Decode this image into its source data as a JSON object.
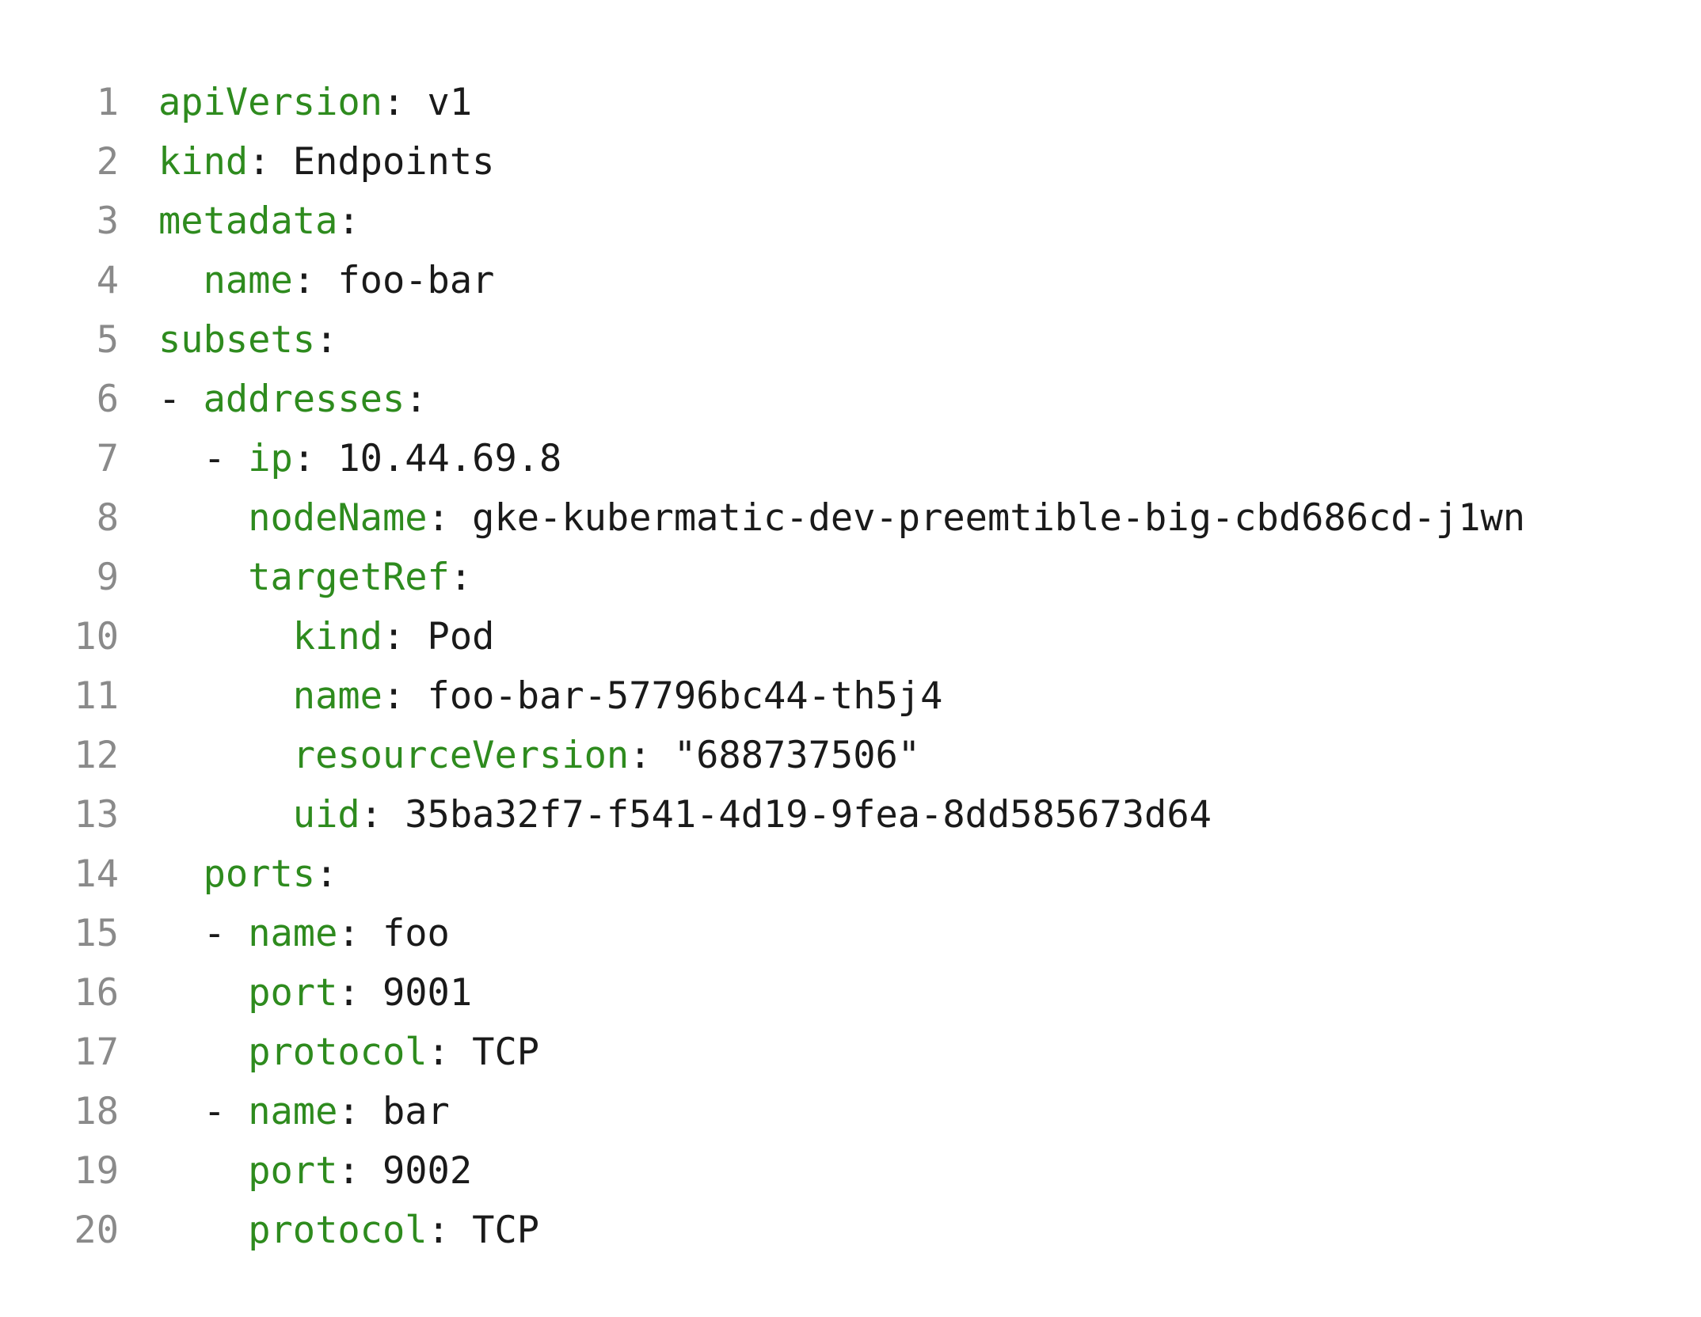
{
  "colors": {
    "background": "#ffffff",
    "key": "#2e8b1e",
    "text": "#1a1a1a",
    "line_number": "#8a8a8a"
  },
  "lines": [
    {
      "number": "1",
      "indent": "",
      "dash": "",
      "key": "apiVersion",
      "sep": ":",
      "value": " v1"
    },
    {
      "number": "2",
      "indent": "",
      "dash": "",
      "key": "kind",
      "sep": ":",
      "value": " Endpoints"
    },
    {
      "number": "3",
      "indent": "",
      "dash": "",
      "key": "metadata",
      "sep": ":",
      "value": ""
    },
    {
      "number": "4",
      "indent": "  ",
      "dash": "",
      "key": "name",
      "sep": ":",
      "value": " foo-bar"
    },
    {
      "number": "5",
      "indent": "",
      "dash": "",
      "key": "subsets",
      "sep": ":",
      "value": ""
    },
    {
      "number": "6",
      "indent": "",
      "dash": "- ",
      "key": "addresses",
      "sep": ":",
      "value": ""
    },
    {
      "number": "7",
      "indent": "  ",
      "dash": "- ",
      "key": "ip",
      "sep": ":",
      "value": " 10.44.69.8"
    },
    {
      "number": "8",
      "indent": "    ",
      "dash": "",
      "key": "nodeName",
      "sep": ":",
      "value": " gke-kubermatic-dev-preemtible-big-cbd686cd-j1wn"
    },
    {
      "number": "9",
      "indent": "    ",
      "dash": "",
      "key": "targetRef",
      "sep": ":",
      "value": ""
    },
    {
      "number": "10",
      "indent": "      ",
      "dash": "",
      "key": "kind",
      "sep": ":",
      "value": " Pod"
    },
    {
      "number": "11",
      "indent": "      ",
      "dash": "",
      "key": "name",
      "sep": ":",
      "value": " foo-bar-57796bc44-th5j4"
    },
    {
      "number": "12",
      "indent": "      ",
      "dash": "",
      "key": "resourceVersion",
      "sep": ":",
      "value": " \"688737506\""
    },
    {
      "number": "13",
      "indent": "      ",
      "dash": "",
      "key": "uid",
      "sep": ":",
      "value": " 35ba32f7-f541-4d19-9fea-8dd585673d64"
    },
    {
      "number": "14",
      "indent": "  ",
      "dash": "",
      "key": "ports",
      "sep": ":",
      "value": ""
    },
    {
      "number": "15",
      "indent": "  ",
      "dash": "- ",
      "key": "name",
      "sep": ":",
      "value": " foo"
    },
    {
      "number": "16",
      "indent": "    ",
      "dash": "",
      "key": "port",
      "sep": ":",
      "value": " 9001"
    },
    {
      "number": "17",
      "indent": "    ",
      "dash": "",
      "key": "protocol",
      "sep": ":",
      "value": " TCP"
    },
    {
      "number": "18",
      "indent": "  ",
      "dash": "- ",
      "key": "name",
      "sep": ":",
      "value": " bar"
    },
    {
      "number": "19",
      "indent": "    ",
      "dash": "",
      "key": "port",
      "sep": ":",
      "value": " 9002"
    },
    {
      "number": "20",
      "indent": "    ",
      "dash": "",
      "key": "protocol",
      "sep": ":",
      "value": " TCP"
    }
  ]
}
